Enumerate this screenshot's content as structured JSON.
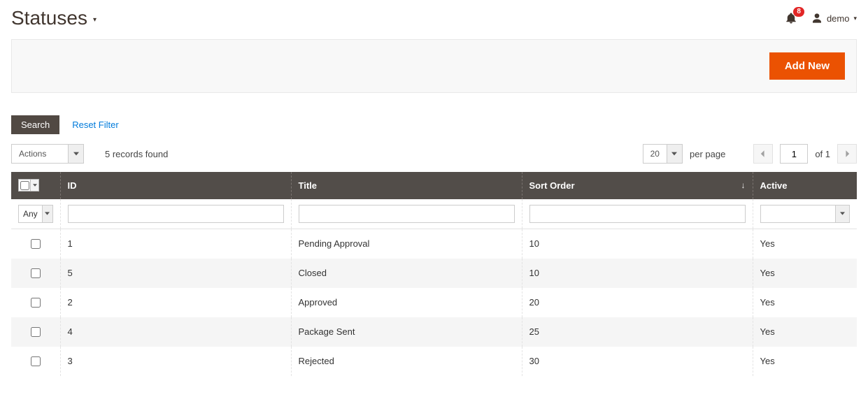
{
  "header": {
    "page_title": "Statuses",
    "notifications_count": "8",
    "user_label": "demo"
  },
  "action_bar": {
    "add_new_label": "Add New"
  },
  "filter_bar": {
    "search_label": "Search",
    "reset_label": "Reset Filter"
  },
  "toolbar": {
    "actions_label": "Actions",
    "records_found": "5 records found",
    "per_page_value": "20",
    "per_page_label": "per page",
    "page_value": "1",
    "of_pages": "of 1"
  },
  "columns": {
    "id": "ID",
    "title": "Title",
    "sort_order": "Sort Order",
    "active": "Active"
  },
  "filters": {
    "any_label": "Any"
  },
  "rows": [
    {
      "id": "1",
      "title": "Pending Approval",
      "sort_order": "10",
      "active": "Yes"
    },
    {
      "id": "5",
      "title": "Closed",
      "sort_order": "10",
      "active": "Yes"
    },
    {
      "id": "2",
      "title": "Approved",
      "sort_order": "20",
      "active": "Yes"
    },
    {
      "id": "4",
      "title": "Package Sent",
      "sort_order": "25",
      "active": "Yes"
    },
    {
      "id": "3",
      "title": "Rejected",
      "sort_order": "30",
      "active": "Yes"
    }
  ]
}
